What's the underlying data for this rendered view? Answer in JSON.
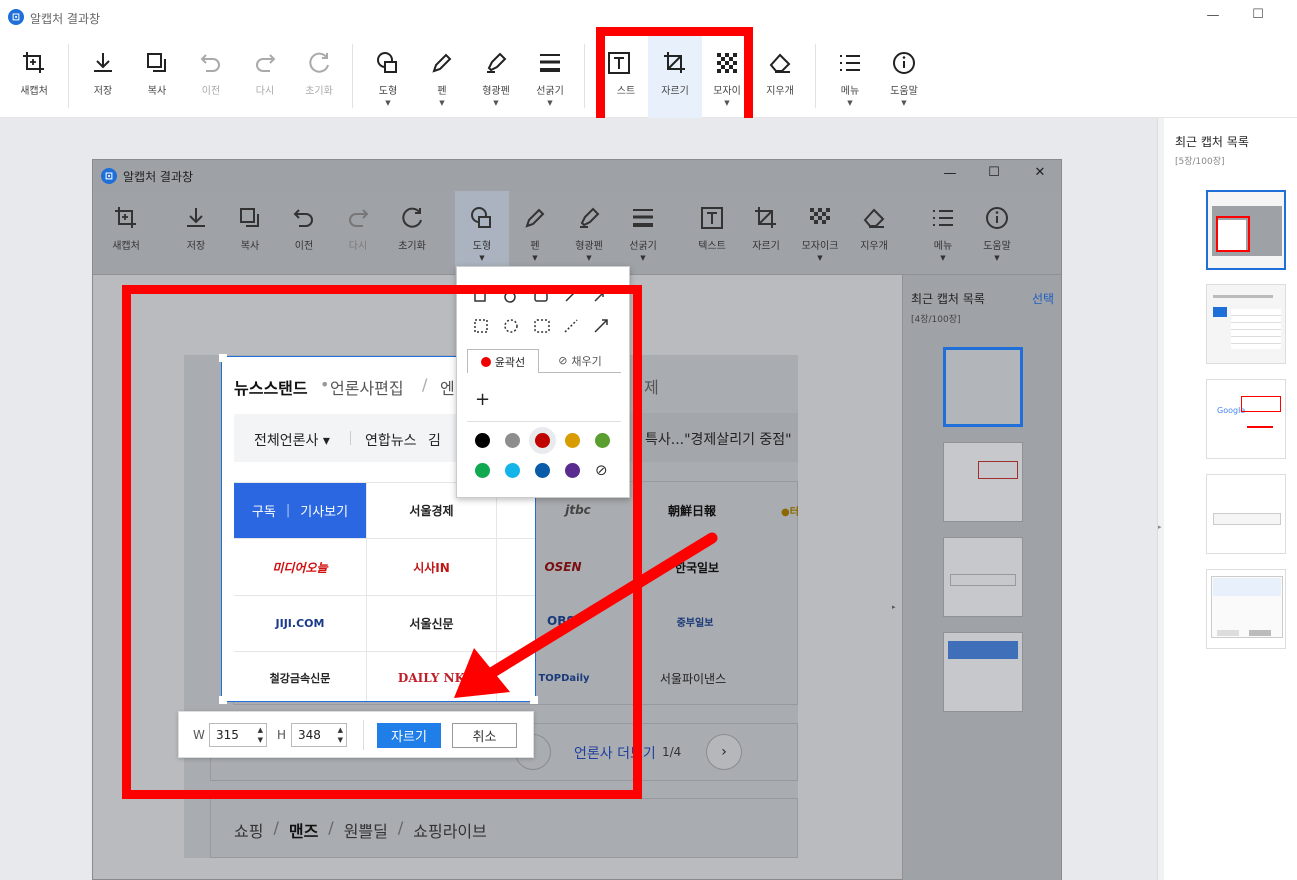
{
  "app": {
    "title": "알캡처 결과창"
  },
  "toolbar": {
    "items": [
      {
        "label": "새캡처"
      },
      {
        "label": "저장"
      },
      {
        "label": "복사"
      },
      {
        "label": "이전"
      },
      {
        "label": "다시"
      },
      {
        "label": "초기화"
      },
      {
        "label": "도형"
      },
      {
        "label": "펜"
      },
      {
        "label": "형광펜"
      },
      {
        "label": "선굵기"
      },
      {
        "label": "텍스트",
        "visible_label": "스트"
      },
      {
        "label": "자르기"
      },
      {
        "label": "모자이크",
        "visible_label": "모자이"
      },
      {
        "label": "지우개"
      },
      {
        "label": "메뉴"
      },
      {
        "label": "도움말"
      }
    ]
  },
  "sidebar": {
    "title": "최근 캡처 목록",
    "count": "[5장/100장]"
  },
  "inner_window": {
    "title": "알캡처 결과창",
    "toolbar": [
      "새캡처",
      "저장",
      "복사",
      "이전",
      "다시",
      "초기화",
      "도형",
      "펜",
      "형광펜",
      "선굵기",
      "텍스트",
      "자르기",
      "모자이크",
      "지우개",
      "메뉴",
      "도움말"
    ],
    "sidebar": {
      "title": "최근 캡처 목록",
      "count": "[4장/100장]",
      "select": "선택"
    }
  },
  "shape_menu": {
    "tab_outline": "윤곽선",
    "tab_fill": "채우기",
    "plus": "+",
    "colors": [
      "#000000",
      "#8e8e8e",
      "#c00000",
      "#d89b00",
      "#5a9e2f",
      "#10a950",
      "#14b4e8",
      "#0a5ba8",
      "#5b2c8f"
    ]
  },
  "newsstand": {
    "header": [
      "뉴스스탠드",
      "•",
      "언론사편집",
      "/",
      "엔",
      "제"
    ],
    "filter": "전체언론사 ▾",
    "ticker": [
      "연합뉴스",
      "김",
      "특사...\"경제살리기 중점\""
    ],
    "tabs": {
      "subscribe": "구독",
      "read": "기사보기"
    },
    "logos": [
      "서울경제",
      "jtbc",
      "朝鮮日報",
      "●터",
      "미디어오늘",
      "시사IN",
      "OSEN",
      "한국일보",
      "JIJI.COM",
      "서울신문",
      "OBS",
      "중부일보",
      "철강금속신문",
      "DAILY NK",
      "TOPDaily",
      "서울파이낸스"
    ],
    "pager": {
      "label": "언론사 더보기",
      "page": "1/4",
      "hidden": "더"
    },
    "shopping": [
      "쇼핑",
      "/",
      "맨즈",
      "/",
      "원쁠딜",
      "/",
      "쇼핑라이브"
    ]
  },
  "crop_panel": {
    "w_label": "W",
    "w_value": "315",
    "h_label": "H",
    "h_value": "348",
    "confirm": "자르기",
    "cancel": "취소"
  },
  "colors": {
    "accent": "#1f7ee8",
    "highlight": "#ff0000"
  }
}
